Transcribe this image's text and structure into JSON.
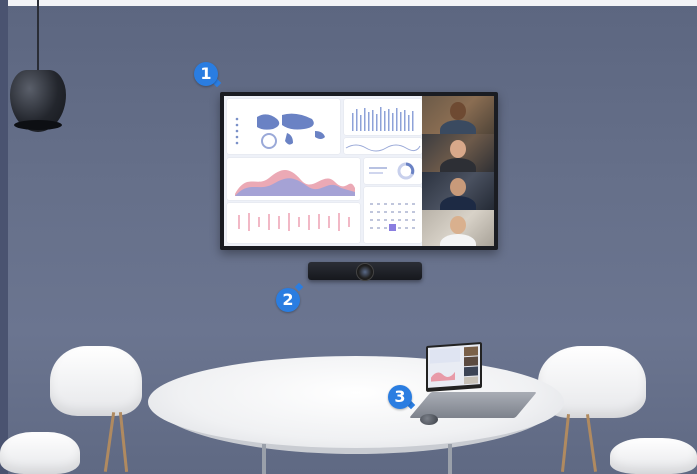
{
  "markers": [
    {
      "id": "display",
      "label": "1"
    },
    {
      "id": "soundbar",
      "label": "2"
    },
    {
      "id": "laptop-puck",
      "label": "3"
    }
  ],
  "colors": {
    "wall": "#66708a",
    "marker": "#2a7de1",
    "table": "#f0f1f3",
    "chair": "#ffffff"
  },
  "icons": {
    "marker_tail": "pointer-triangle"
  }
}
